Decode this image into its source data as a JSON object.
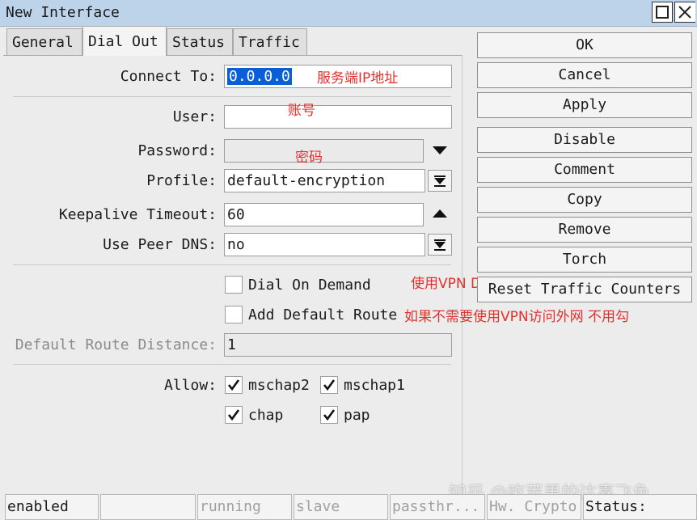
{
  "window": {
    "title": "New Interface"
  },
  "tabs": [
    {
      "label": "General"
    },
    {
      "label": "Dial Out"
    },
    {
      "label": "Status"
    },
    {
      "label": "Traffic"
    }
  ],
  "form": {
    "connect_to": {
      "label": "Connect To:",
      "value": "0.0.0.0"
    },
    "user": {
      "label": "User:",
      "value": ""
    },
    "password": {
      "label": "Password:",
      "value": ""
    },
    "profile": {
      "label": "Profile:",
      "value": "default-encryption"
    },
    "keepalive": {
      "label": "Keepalive Timeout:",
      "value": "60"
    },
    "peer_dns": {
      "label": "Use Peer DNS:",
      "value": "no"
    },
    "dial_on_demand": {
      "label": "Dial On Demand",
      "checked": false
    },
    "add_default_route": {
      "label": "Add Default Route",
      "checked": false
    },
    "route_distance": {
      "label": "Default Route Distance:",
      "value": "1"
    },
    "allow": {
      "label": "Allow:",
      "options": [
        {
          "label": "mschap2",
          "checked": true
        },
        {
          "label": "mschap1",
          "checked": true
        },
        {
          "label": "chap",
          "checked": true
        },
        {
          "label": "pap",
          "checked": true
        }
      ]
    }
  },
  "annotations": {
    "server_ip": "服务端IP地址",
    "account": "账号",
    "password": "密码",
    "vpn_dns": "使用VPN DNS",
    "default_route": "如果不需要使用VPN访问外网 不用勾"
  },
  "buttons": {
    "ok": "OK",
    "cancel": "Cancel",
    "apply": "Apply",
    "disable": "Disable",
    "comment": "Comment",
    "copy": "Copy",
    "remove": "Remove",
    "torch": "Torch",
    "reset": "Reset Traffic Counters"
  },
  "statusbar": {
    "state": "enabled",
    "blank": "",
    "running": "running",
    "slave": "slave",
    "passthrough": "passthr...",
    "hw_crypto": "Hw. Crypto",
    "status": "Status:"
  },
  "watermark": "知乎 @吃苹果的达喜飞鱼",
  "colors": {
    "annotation": "#e0322d",
    "selection": "#0a5fd6",
    "titlebar": "#bdd3ea"
  }
}
